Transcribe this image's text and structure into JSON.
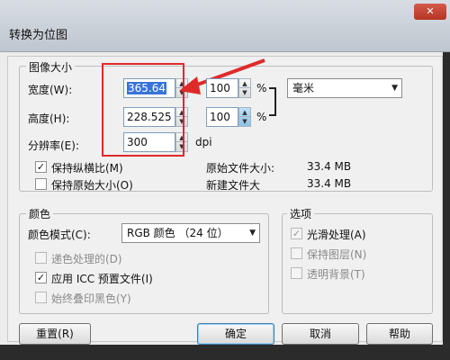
{
  "window": {
    "title": "转换为位图",
    "close_symbol": "✕"
  },
  "image_size": {
    "legend": "图像大小",
    "width_label": "宽度(W):",
    "width_value": "365.64",
    "height_label": "高度(H):",
    "height_value": "228.525",
    "resolution_label": "分辨率(E):",
    "resolution_value": "300",
    "resolution_unit": "dpi",
    "width_percent": "100",
    "height_percent": "100",
    "percent_symbol": "%",
    "unit_select": "毫米",
    "keep_aspect_label": "保持纵横比(M)",
    "keep_original_label": "保持原始大小(O)",
    "original_file_size_label": "原始文件大小:",
    "original_file_size_value": "33.4 MB",
    "new_file_size_label": "新建文件大",
    "new_file_size_value": "33.4 MB"
  },
  "color": {
    "legend": "颜色",
    "mode_label": "颜色模式(C):",
    "mode_value": "RGB 颜色 （24 位）",
    "dither_label": "递色处理的(D)",
    "icc_label": "应用 ICC 预置文件(I)",
    "overprint_label": "始终叠印黑色(Y)"
  },
  "options": {
    "legend": "选项",
    "antialias_label": "光滑处理(A)",
    "keep_layers_label": "保持图层(N)",
    "transparent_label": "透明背景(T)"
  },
  "buttons": {
    "reset": "重置(R)",
    "ok": "确定",
    "cancel": "取消",
    "help": "帮助"
  },
  "colors": {
    "annotation_red": "#e02a2a",
    "selection_blue": "#3874d8"
  }
}
